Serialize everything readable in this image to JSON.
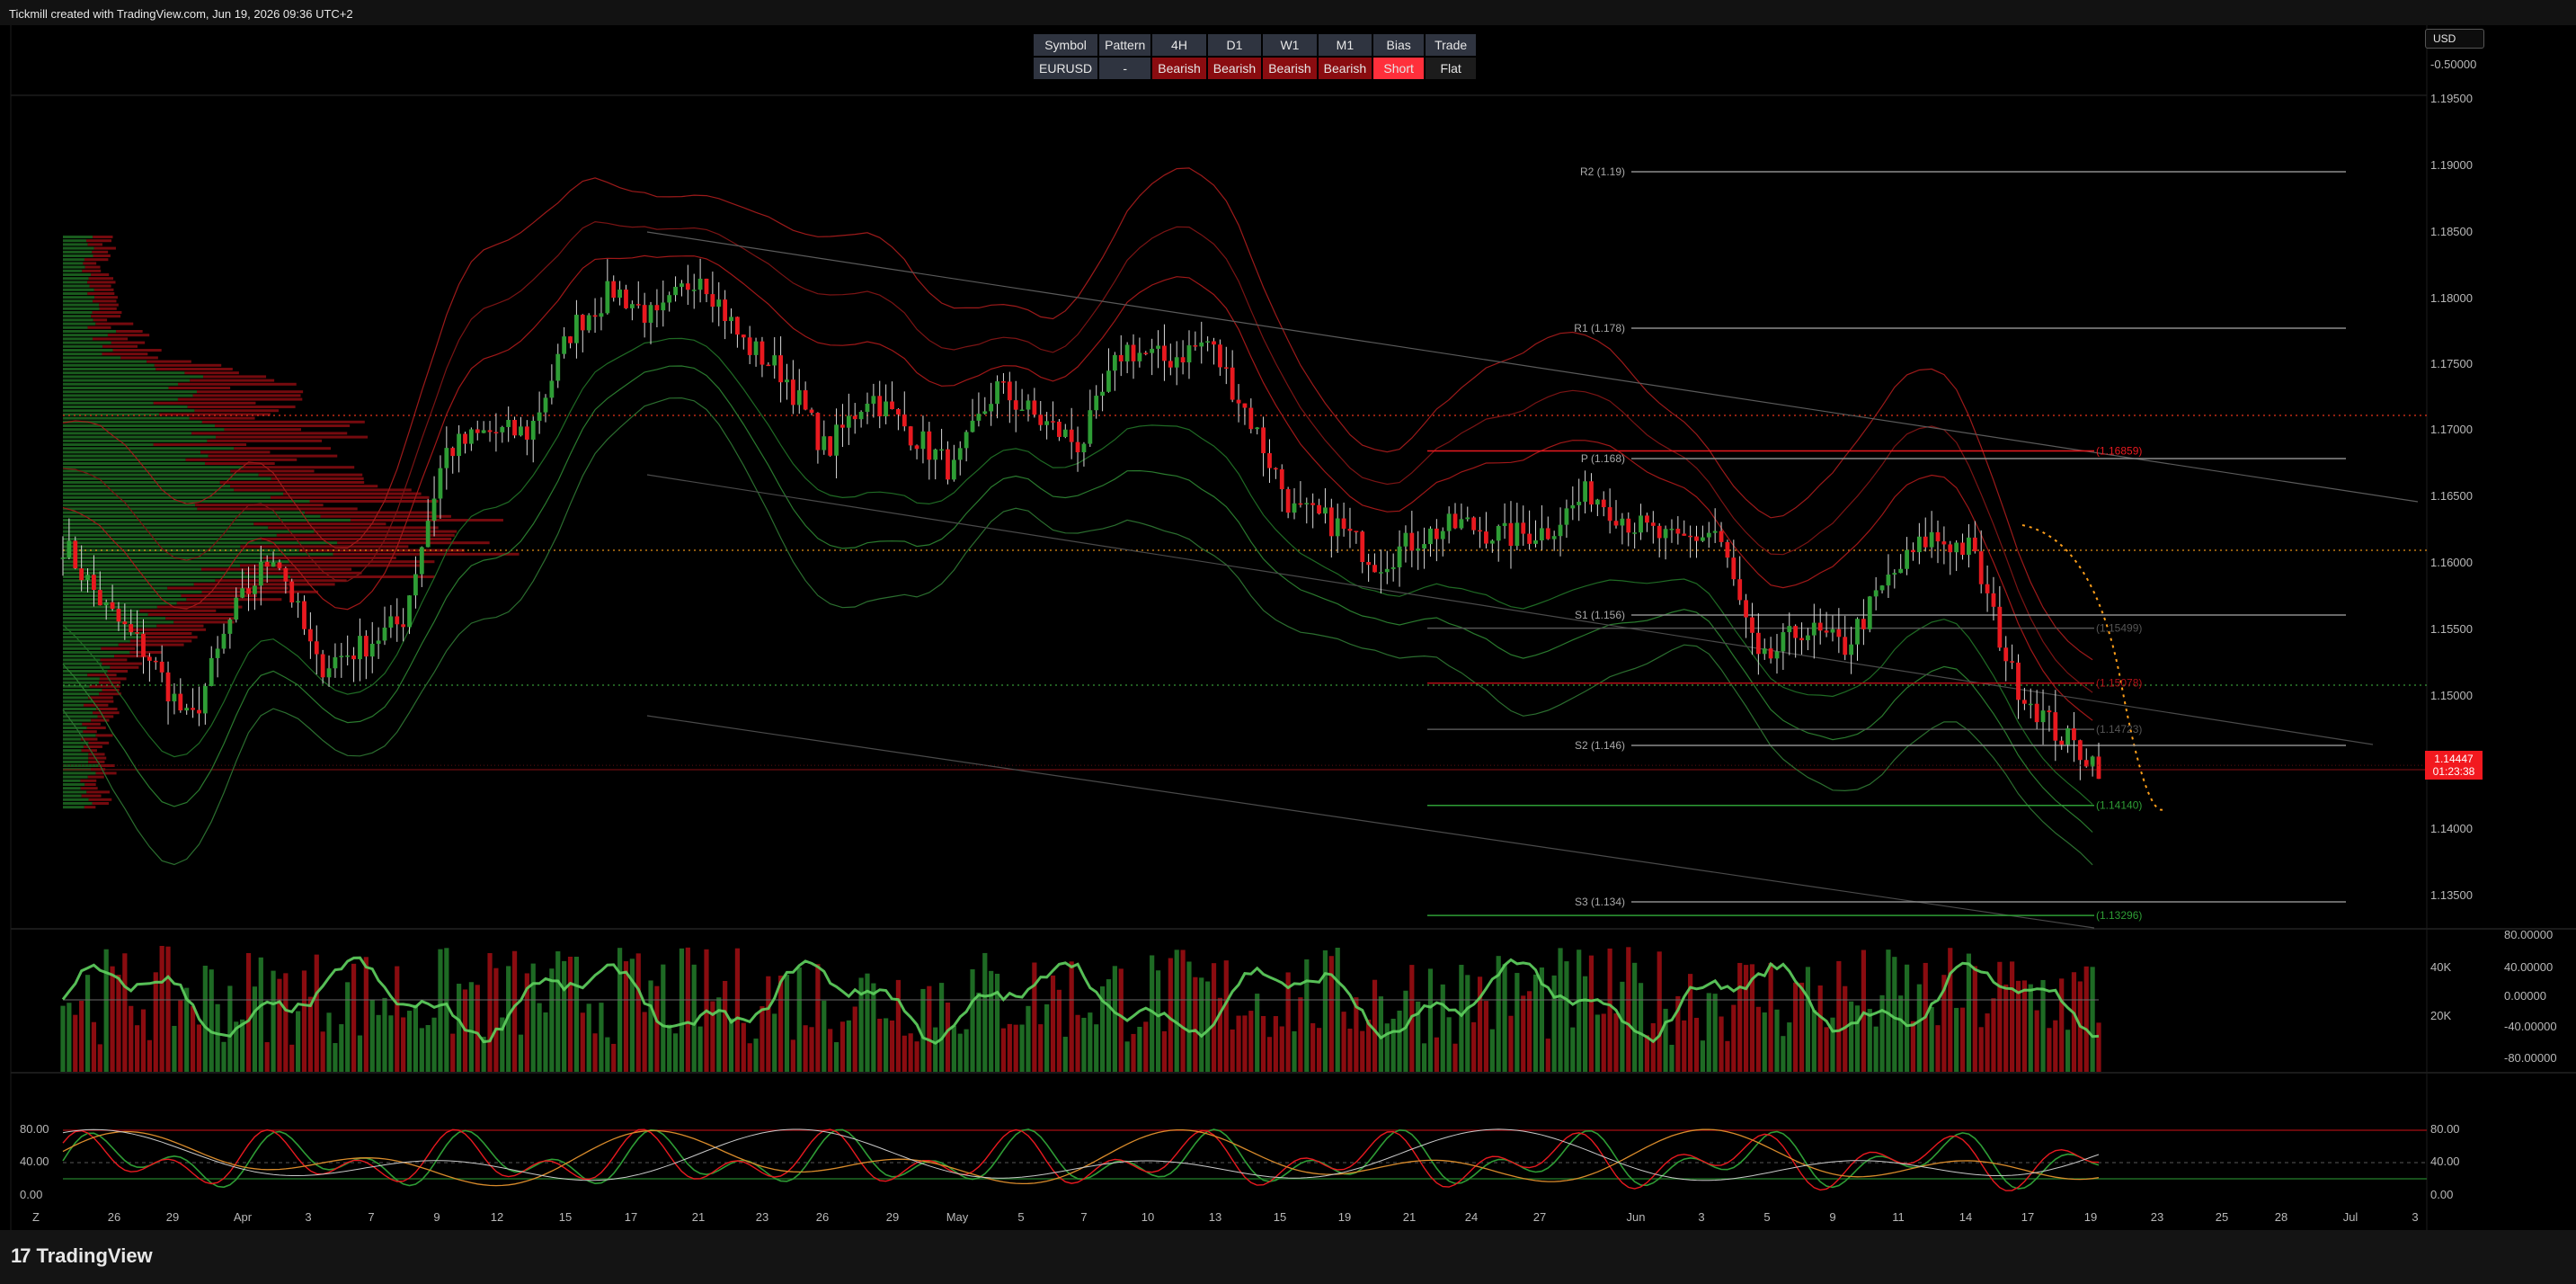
{
  "header": {
    "text": "Tickmill created with TradingView.com, Jun 19, 2026 09:36 UTC+2"
  },
  "brand": {
    "logo_text": "17",
    "name": "TradingView"
  },
  "currency": "USD",
  "bias_table": {
    "headers": [
      "Symbol",
      "Pattern",
      "4H",
      "D1",
      "W1",
      "M1",
      "Bias",
      "Trade"
    ],
    "values": [
      "EURUSD",
      "-",
      "Bearish",
      "Bearish",
      "Bearish",
      "Bearish",
      "Short",
      "Flat"
    ]
  },
  "price_tag": {
    "price": "1.14447",
    "countdown": "01:23:38"
  },
  "colors": {
    "bull": "#2e9d35",
    "bear": "#e8191f",
    "bear_dark": "#8a0c10",
    "grid": "#1a1a1a",
    "accent_orange": "#ff9f1a"
  },
  "chart_data": [
    {
      "type": "candlestick",
      "symbol": "EURUSD",
      "y_axis": {
        "ticks": [
          "0.00000",
          "-0.50000",
          "1.19500",
          "1.19000",
          "1.18500",
          "1.18000",
          "1.17500",
          "1.17000",
          "1.16500",
          "1.16000",
          "1.15500",
          "1.15000",
          "1.14500",
          "1.14000",
          "1.13500"
        ],
        "ylim": [
          1.132,
          1.196
        ]
      },
      "x_axis": {
        "ticks": [
          "Z",
          "26",
          "29",
          "Apr",
          "3",
          "7",
          "9",
          "12",
          "15",
          "17",
          "21",
          "23",
          "26",
          "29",
          "May",
          "5",
          "7",
          "10",
          "13",
          "15",
          "19",
          "21",
          "24",
          "27",
          "Jun",
          "3",
          "5",
          "9",
          "11",
          "14",
          "17",
          "19",
          "23",
          "25",
          "28",
          "Jul",
          "3"
        ]
      },
      "close_path": [
        {
          "x": "Mar 22",
          "y": 1.1615
        },
        {
          "x": "Mar 24",
          "y": 1.1565
        },
        {
          "x": "Mar 26",
          "y": 1.153
        },
        {
          "x": "Mar 28",
          "y": 1.1475
        },
        {
          "x": "Mar 30",
          "y": 1.156
        },
        {
          "x": "Apr 1",
          "y": 1.161
        },
        {
          "x": "Apr 3",
          "y": 1.152
        },
        {
          "x": "Apr 5",
          "y": 1.1535
        },
        {
          "x": "Apr 7",
          "y": 1.1555
        },
        {
          "x": "Apr 8",
          "y": 1.1685
        },
        {
          "x": "Apr 10",
          "y": 1.17
        },
        {
          "x": "Apr 12",
          "y": 1.17
        },
        {
          "x": "Apr 13",
          "y": 1.178
        },
        {
          "x": "Apr 15",
          "y": 1.181
        },
        {
          "x": "Apr 16",
          "y": 1.1785
        },
        {
          "x": "Apr 17",
          "y": 1.1825
        },
        {
          "x": "Apr 19",
          "y": 1.177
        },
        {
          "x": "Apr 21",
          "y": 1.1745
        },
        {
          "x": "Apr 23",
          "y": 1.1685
        },
        {
          "x": "Apr 25",
          "y": 1.173
        },
        {
          "x": "Apr 27",
          "y": 1.17
        },
        {
          "x": "Apr 29",
          "y": 1.167
        },
        {
          "x": "May 1",
          "y": 1.1735
        },
        {
          "x": "May 3",
          "y": 1.171
        },
        {
          "x": "May 5",
          "y": 1.169
        },
        {
          "x": "May 7",
          "y": 1.1765
        },
        {
          "x": "May 9",
          "y": 1.1755
        },
        {
          "x": "May 11",
          "y": 1.177
        },
        {
          "x": "May 13",
          "y": 1.171
        },
        {
          "x": "May 15",
          "y": 1.164
        },
        {
          "x": "May 17",
          "y": 1.163
        },
        {
          "x": "May 19",
          "y": 1.16
        },
        {
          "x": "May 21",
          "y": 1.162
        },
        {
          "x": "May 23",
          "y": 1.163
        },
        {
          "x": "May 25",
          "y": 1.162
        },
        {
          "x": "May 27",
          "y": 1.1625
        },
        {
          "x": "May 29",
          "y": 1.1655
        },
        {
          "x": "May 31",
          "y": 1.163
        },
        {
          "x": "Jun 3",
          "y": 1.1615
        },
        {
          "x": "Jun 5",
          "y": 1.1625
        },
        {
          "x": "Jun 7",
          "y": 1.152
        },
        {
          "x": "Jun 9",
          "y": 1.155
        },
        {
          "x": "Jun 11",
          "y": 1.1535
        },
        {
          "x": "Jun 13",
          "y": 1.1585
        },
        {
          "x": "Jun 15",
          "y": 1.162
        },
        {
          "x": "Jun 16",
          "y": 1.161
        },
        {
          "x": "Jun 17",
          "y": 1.151
        },
        {
          "x": "Jun 18",
          "y": 1.147
        },
        {
          "x": "Jun 19",
          "y": 1.1445
        }
      ],
      "levels": [
        {
          "label": "R2 (1.19)",
          "value": 1.19
        },
        {
          "label": "R1 (1.178)",
          "value": 1.178
        },
        {
          "label": "P (1.168)",
          "value": 1.168
        },
        {
          "label": "S1 (1.156)",
          "value": 1.156
        },
        {
          "label": "S2 (1.146)",
          "value": 1.146
        },
        {
          "label": "S3 (1.134)",
          "value": 1.134
        }
      ],
      "price_labels": [
        {
          "label": "(1.16859)",
          "value": 1.16859,
          "color": "#e8191f"
        },
        {
          "label": "(1.15499)",
          "value": 1.15499,
          "color": "#555555"
        },
        {
          "label": "(1.15078)",
          "value": 1.15078,
          "color": "#b01016"
        },
        {
          "label": "(1.14723)",
          "value": 1.14723,
          "color": "#555555"
        },
        {
          "label": "(1.14140)",
          "value": 1.1414,
          "color": "#2e9d35"
        },
        {
          "label": "(1.13296)",
          "value": 1.13296,
          "color": "#2e9d35"
        }
      ],
      "last_price": 1.14447
    },
    {
      "type": "bar",
      "name": "volume",
      "right_axis": [
        "40K",
        "20K"
      ],
      "far_axis": [
        "80.00000",
        "40.00000",
        "0.00000",
        "-40.00000",
        "-80.00000"
      ]
    },
    {
      "type": "line",
      "name": "stochastic",
      "left_axis": [
        "80.00",
        "40.00",
        "0.00"
      ],
      "right_axis": [
        "80.00",
        "40.00",
        "0.00"
      ]
    }
  ]
}
